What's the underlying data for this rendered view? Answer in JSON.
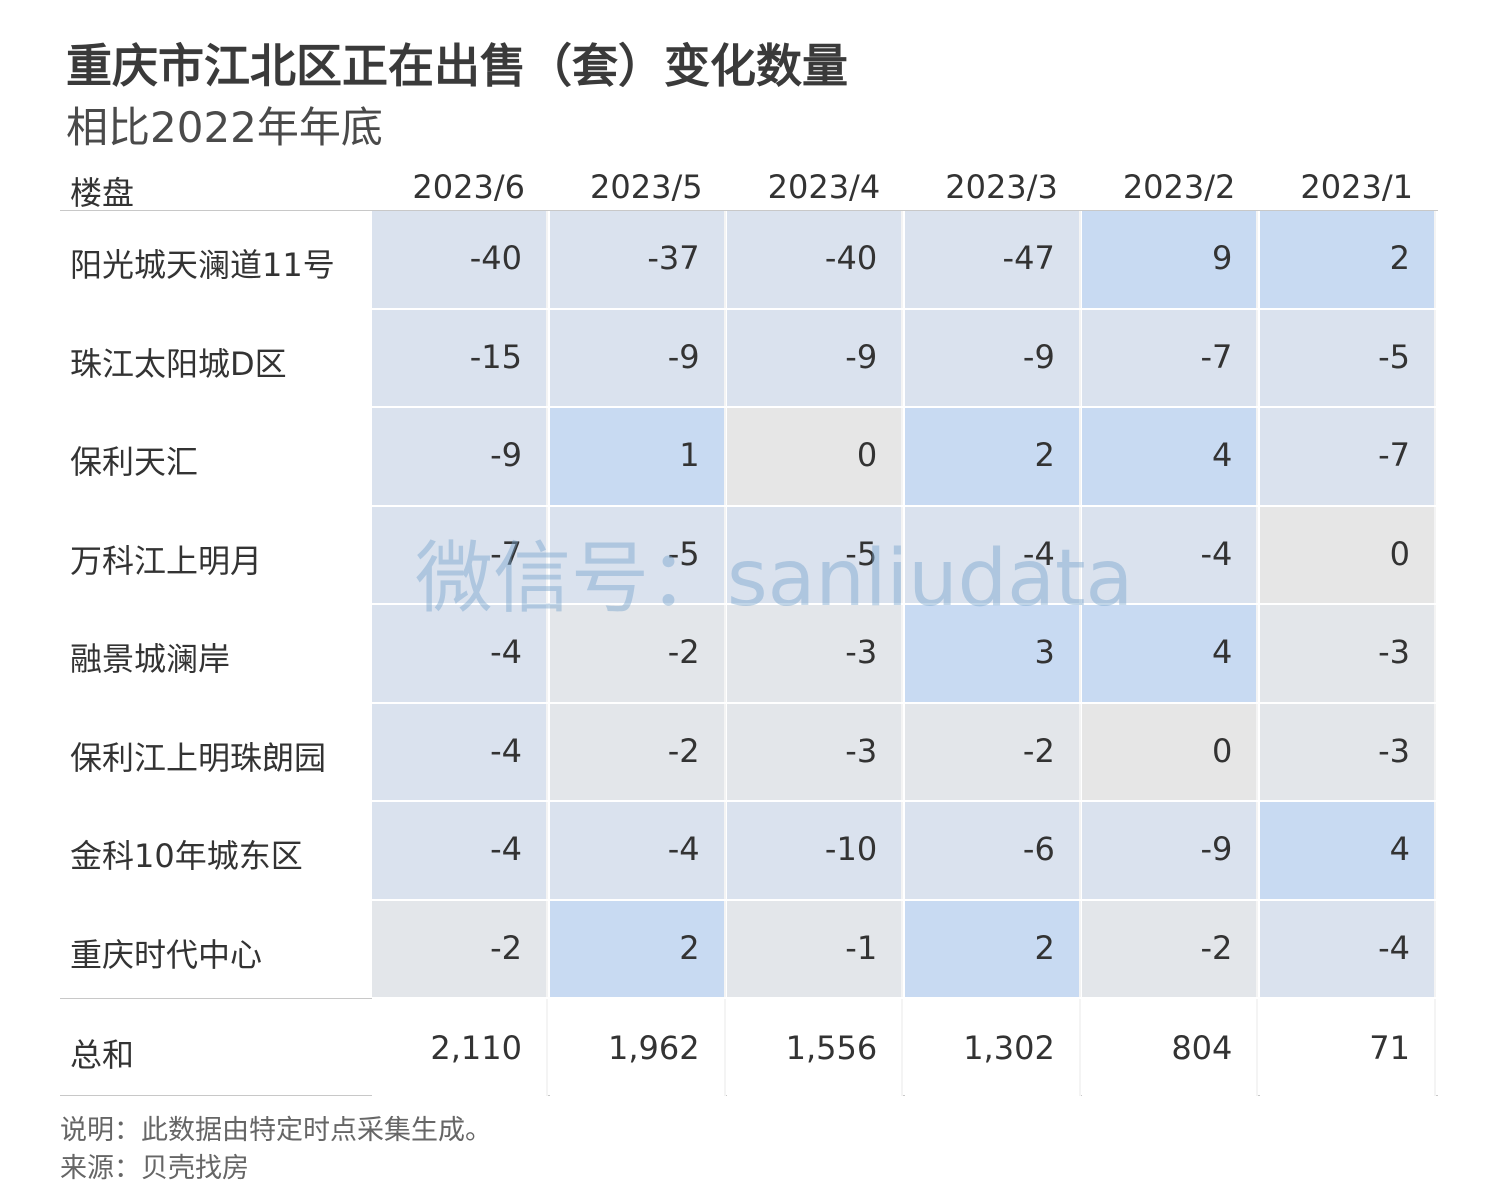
{
  "title": "重庆市江北区正在出售（套）变化数量",
  "subtitle": "相比2022年年底",
  "watermark": "微信号：sanliudata",
  "notes": [
    "说明：此数据由特定时点采集生成。",
    "来源：贝壳找房"
  ],
  "colors": {
    "neutral": "#e3e6ea",
    "blue_light": "#dae2ee",
    "blue": "#c8daf2",
    "grey": "#e6e6e6"
  },
  "chart_data": {
    "type": "table",
    "row_header": "楼盘",
    "columns": [
      "2023/6",
      "2023/5",
      "2023/4",
      "2023/3",
      "2023/2",
      "2023/1"
    ],
    "rows": [
      {
        "name": "阳光城天澜道11号",
        "values": [
          "-40",
          "-37",
          "-40",
          "-47",
          "9",
          "2"
        ]
      },
      {
        "name": "珠江太阳城D区",
        "values": [
          "-15",
          "-9",
          "-9",
          "-9",
          "-7",
          "-5"
        ]
      },
      {
        "name": "保利天汇",
        "values": [
          "-9",
          "1",
          "0",
          "2",
          "4",
          "-7"
        ]
      },
      {
        "name": "万科江上明月",
        "values": [
          "-7",
          "-5",
          "-5",
          "-4",
          "-4",
          "0"
        ]
      },
      {
        "name": "融景城澜岸",
        "values": [
          "-4",
          "-2",
          "-3",
          "3",
          "4",
          "-3"
        ]
      },
      {
        "name": "保利江上明珠朗园",
        "values": [
          "-4",
          "-2",
          "-3",
          "-2",
          "0",
          "-3"
        ]
      },
      {
        "name": "金科10年城东区",
        "values": [
          "-4",
          "-4",
          "-10",
          "-6",
          "-9",
          "4"
        ]
      },
      {
        "name": "重庆时代中心",
        "values": [
          "-2",
          "2",
          "-1",
          "2",
          "-2",
          "-4"
        ]
      }
    ],
    "total": {
      "name": "总和",
      "values": [
        "2,110",
        "1,962",
        "1,556",
        "1,302",
        "804",
        "71"
      ]
    }
  }
}
